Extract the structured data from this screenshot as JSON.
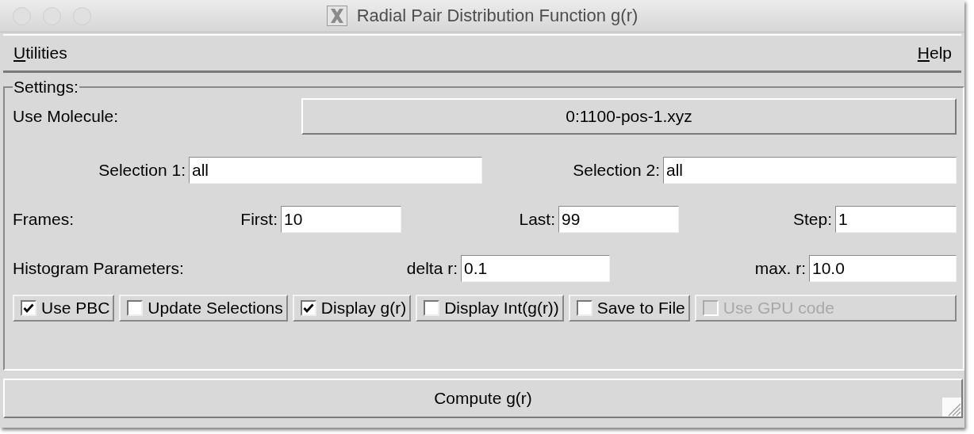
{
  "window": {
    "title": "Radial Pair Distribution Function g(r)"
  },
  "menu": [
    {
      "label": "Utilities"
    },
    {
      "label": "Help"
    }
  ],
  "settings": {
    "title": "Settings:",
    "molecule": {
      "label": "Use Molecule:",
      "value": "0:1100-pos-1.xyz"
    },
    "selections": [
      {
        "label": "Selection 1:",
        "value": "all"
      },
      {
        "label": "Selection 2:",
        "value": "all"
      }
    ],
    "frames": {
      "label": "Frames:",
      "fields": [
        {
          "label": "First:",
          "value": "10"
        },
        {
          "label": "Last:",
          "value": "99"
        },
        {
          "label": "Step:",
          "value": "1"
        }
      ]
    },
    "histogram": {
      "label": "Histogram Parameters:",
      "fields": [
        {
          "label": "delta r:",
          "value": "0.1"
        },
        {
          "label": "max. r:",
          "value": "10.0"
        }
      ]
    },
    "options": [
      {
        "label": "Use PBC",
        "checked": true,
        "disabled": false
      },
      {
        "label": "Update Selections",
        "checked": false,
        "disabled": false
      },
      {
        "label": "Display g(r)",
        "checked": true,
        "disabled": false
      },
      {
        "label": "Display Int(g(r))",
        "checked": false,
        "disabled": false
      },
      {
        "label": "Save to File",
        "checked": false,
        "disabled": false
      },
      {
        "label": "Use GPU code",
        "checked": false,
        "disabled": true
      }
    ]
  },
  "compute_button": {
    "label": "Compute g(r)"
  }
}
